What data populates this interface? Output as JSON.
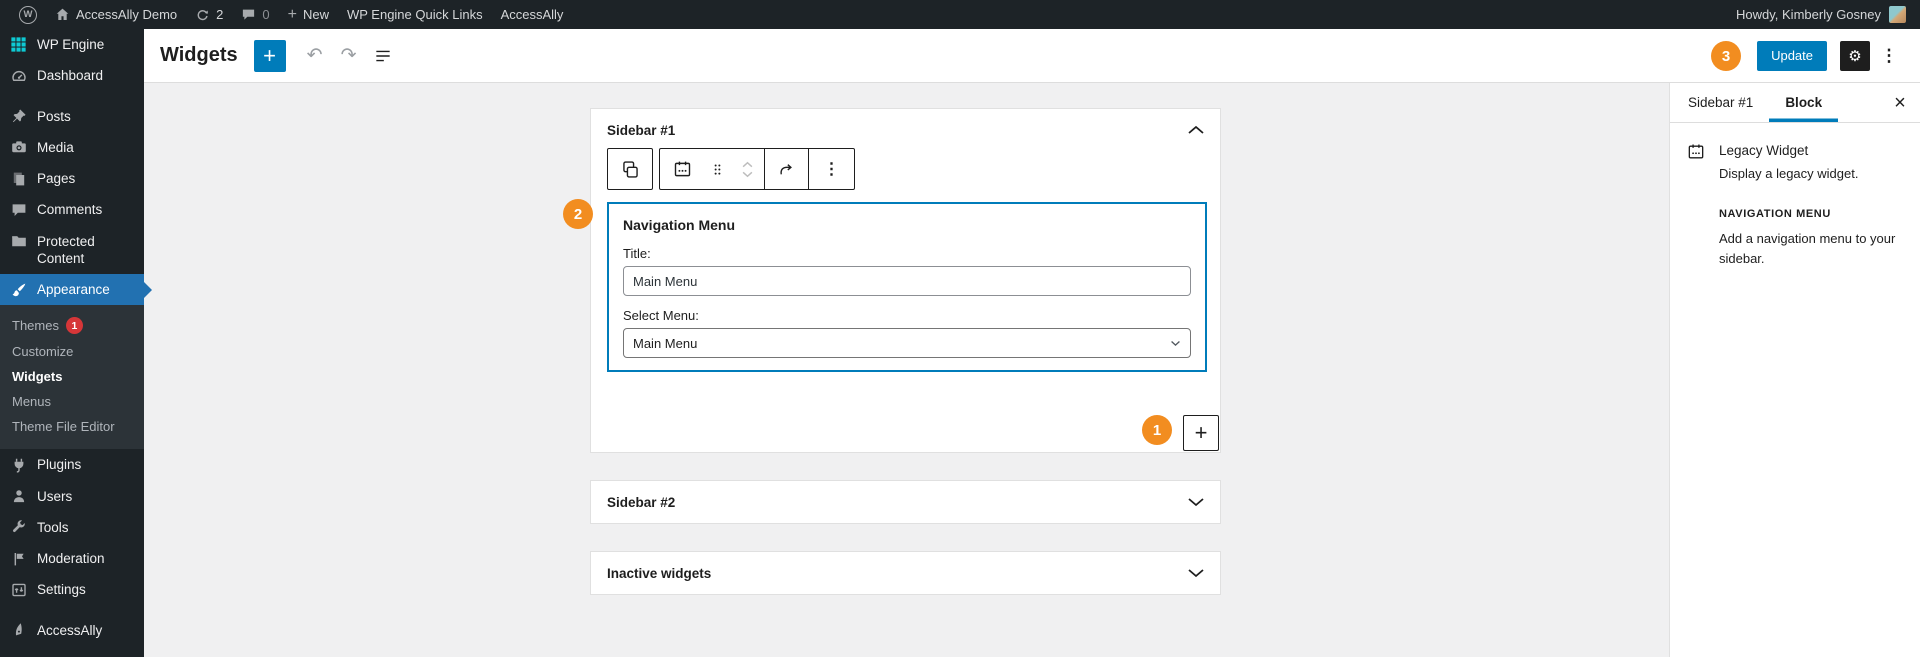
{
  "admin_bar": {
    "site_name": "AccessAlly Demo",
    "updates_count": "2",
    "comments_count": "0",
    "new_label": "New",
    "quick_links_label": "WP Engine Quick Links",
    "accessally_label": "AccessAlly",
    "howdy": "Howdy, Kimberly Gosney"
  },
  "admin_menu": {
    "items": [
      {
        "label": "WP Engine"
      },
      {
        "label": "Dashboard"
      },
      {
        "label": "Posts"
      },
      {
        "label": "Media"
      },
      {
        "label": "Pages"
      },
      {
        "label": "Comments"
      },
      {
        "label": "Protected Content"
      },
      {
        "label": "Appearance"
      },
      {
        "label": "Plugins"
      },
      {
        "label": "Users"
      },
      {
        "label": "Tools"
      },
      {
        "label": "Moderation"
      },
      {
        "label": "Settings"
      },
      {
        "label": "AccessAlly"
      }
    ],
    "appearance_submenu": [
      {
        "label": "Themes",
        "badge": "1"
      },
      {
        "label": "Customize"
      },
      {
        "label": "Widgets"
      },
      {
        "label": "Menus"
      },
      {
        "label": "Theme File Editor"
      }
    ]
  },
  "editor_header": {
    "title": "Widgets",
    "update_label": "Update"
  },
  "widget_areas": {
    "sidebar1": {
      "title": "Sidebar #1",
      "block": {
        "heading": "Navigation Menu",
        "title_label": "Title:",
        "title_value": "Main Menu",
        "select_label": "Select Menu:",
        "select_value": "Main Menu"
      }
    },
    "sidebar2": {
      "title": "Sidebar #2"
    },
    "inactive": {
      "title": "Inactive widgets"
    }
  },
  "inspector": {
    "tabs": {
      "area": "Sidebar #1",
      "block": "Block"
    },
    "block_card": {
      "name": "Legacy Widget",
      "description": "Display a legacy widget."
    },
    "widget_info": {
      "heading": "NAVIGATION MENU",
      "description": "Add a navigation menu to your sidebar."
    }
  },
  "annotations": {
    "step1": "1",
    "step2": "2",
    "step3": "3"
  },
  "colors": {
    "accent_blue": "#007cba",
    "menu_active_blue": "#2271b1",
    "annotation_orange": "#f28d20",
    "badge_red": "#d63638",
    "wp_engine_teal": "#0ecad4",
    "admin_dark": "#1d2327"
  }
}
